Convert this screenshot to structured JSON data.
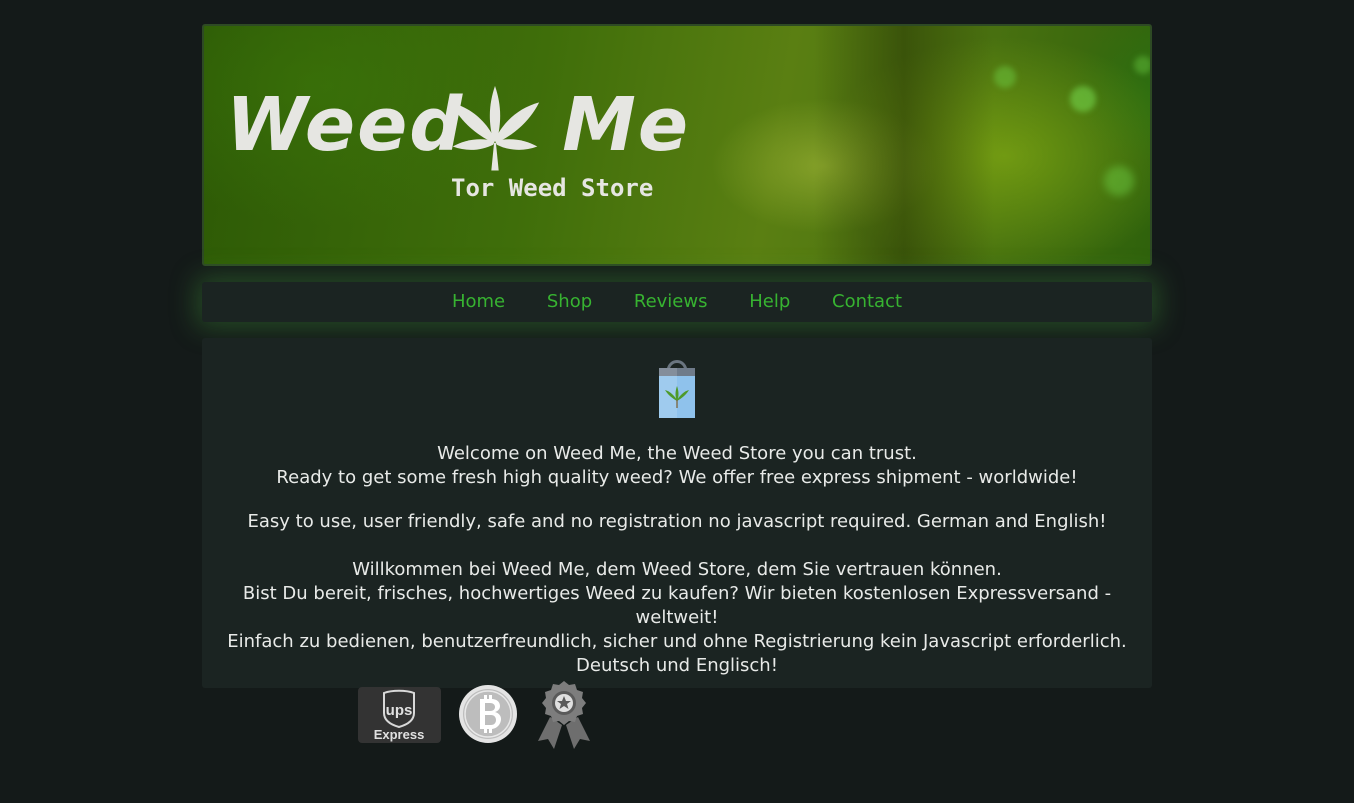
{
  "banner": {
    "logo_title_left": "Weed",
    "logo_title_right": "Me",
    "logo_subtitle": "Tor Weed Store"
  },
  "nav": {
    "items": [
      {
        "label": "Home"
      },
      {
        "label": "Shop"
      },
      {
        "label": "Reviews"
      },
      {
        "label": "Help"
      },
      {
        "label": "Contact"
      }
    ]
  },
  "content": {
    "icon": "shopping-bag-icon",
    "english": {
      "line1": "Welcome on Weed Me, the Weed Store you can trust.",
      "line2": "Ready to get some fresh high quality weed? We offer free express shipment - worldwide!",
      "line3": "Easy to use, user friendly, safe and no registration no javascript required. German and English!"
    },
    "german": {
      "line1": "Willkommen bei Weed Me, dem Weed Store, dem Sie vertrauen können.",
      "line2": "Bist Du bereit, frisches, hochwertiges Weed zu kaufen? Wir bieten kostenlosen Expressversand - weltweit!",
      "line3": "Einfach zu bedienen, benutzerfreundlich, sicher und ohne Registrierung kein Javascript erforderlich.",
      "line4": "Deutsch und Englisch!"
    }
  },
  "badges": {
    "ups_top": "ups",
    "ups_bottom": "Express",
    "items": [
      "ups-express-icon",
      "bitcoin-icon",
      "award-ribbon-icon"
    ]
  },
  "colors": {
    "background": "#141a19",
    "panel": "#1b2422",
    "nav_link": "#37b331",
    "text": "#e8eae8"
  }
}
